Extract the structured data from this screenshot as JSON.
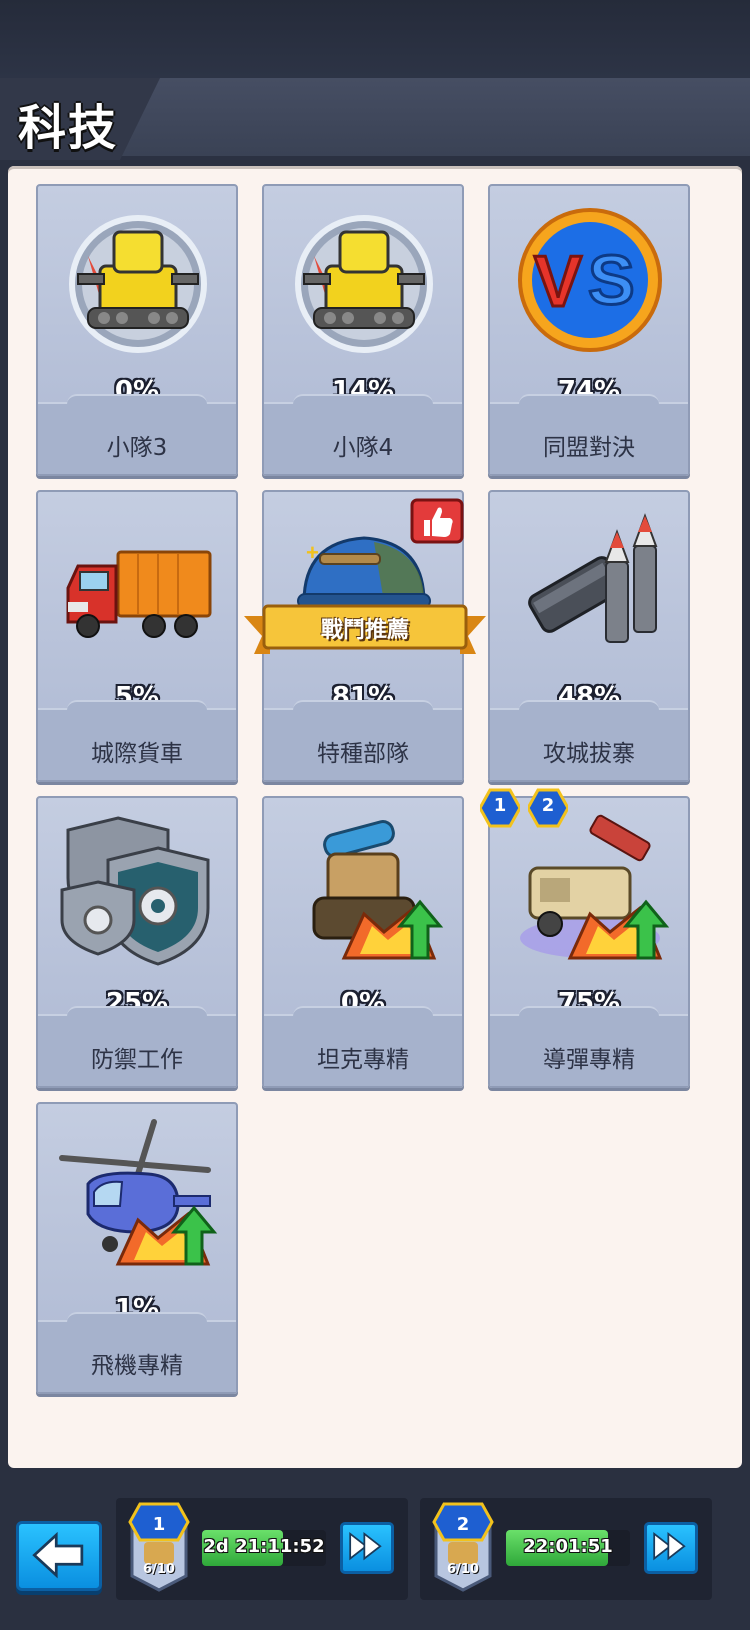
{
  "header": {
    "title": "科技"
  },
  "cards": [
    {
      "percent": "0%",
      "label": "小隊3",
      "icon": "yellow-tank-medal-icon"
    },
    {
      "percent": "14%",
      "label": "小隊4",
      "icon": "yellow-tank-medal-icon"
    },
    {
      "percent": "74%",
      "label": "同盟對決",
      "icon": "vs-icon"
    },
    {
      "percent": "5%",
      "label": "城際貨車",
      "icon": "truck-icon"
    },
    {
      "percent": "81%",
      "label": "特種部隊",
      "icon": "soldier-helmet-icon",
      "banner": "戰鬥推薦",
      "recommended": true
    },
    {
      "percent": "48%",
      "label": "攻城拔寨",
      "icon": "rocket-launcher-icon"
    },
    {
      "percent": "25%",
      "label": "防禦工作",
      "icon": "shields-gear-icon"
    },
    {
      "percent": "0%",
      "label": "坦克專精",
      "icon": "tank-upgrade-icon"
    },
    {
      "percent": "75%",
      "label": "導彈專精",
      "icon": "missile-upgrade-icon",
      "badges": [
        "1",
        "2"
      ]
    },
    {
      "percent": "1%",
      "label": "飛機專精",
      "icon": "helicopter-upgrade-icon"
    }
  ],
  "bottom_bar": {
    "slots": [
      {
        "level": "1",
        "count": "6/10",
        "timer": "2d 21:11:52",
        "progress": 0.65
      },
      {
        "level": "2",
        "count": "6/10",
        "timer": "22:01:51",
        "progress": 0.82
      }
    ]
  },
  "colors": {
    "accent_blue": "#12a4f0",
    "timer_green": "#3fbf45",
    "card_bg": "#b8c3da",
    "panel_bg": "#fbf3ef"
  }
}
